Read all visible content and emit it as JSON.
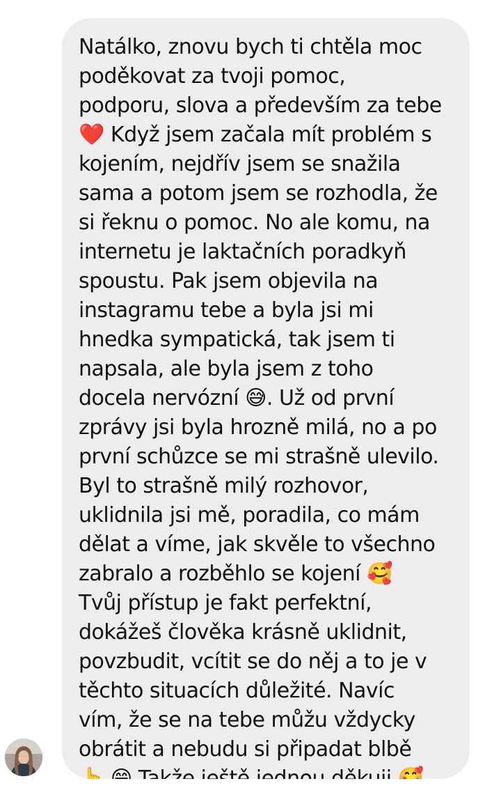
{
  "message": {
    "lines": [
      "Natálko, znovu bych ti chtěla moc",
      "poděkovat za tvoji pomoc,",
      "podporu, slova a především za tebe",
      "❤️ Když jsem začala mít problém s",
      "kojením, nejdřív jsem se snažila",
      "sama a potom jsem se rozhodla, že",
      "si řeknu o pomoc. No ale komu, na",
      "internetu je laktačních poradkyň",
      "spoustu. Pak jsem objevila na",
      "instagramu tebe a byla jsi mi",
      "hnedka sympatická, tak jsem ti",
      "napsala, ale byla jsem z toho",
      "docela nervózní 😅. Už od první",
      "zprávy jsi byla hrozně milá, no a po",
      "první schůzce se mi strašně ulevilo.",
      "Byl to strašně milý rozhovor,",
      "uklidnila jsi mě, poradila, co mám",
      "dělat a víme, jak skvěle to všechno",
      "zabralo a rozběhlo se kojení 🥰",
      "Tvůj přístup je fakt perfektní,",
      "dokážeš člověka krásně uklidnit,",
      "povzbudit, vcítit se do něj a to je v",
      "těchto situacích důležité. Navíc",
      "vím, že se na tebe můžu vždycky",
      "obrátit a nebudu si připadat blbě",
      "👆 😁 Takže ještě jednou děkuji 🥰"
    ]
  },
  "colors": {
    "bubble": "#ededf0",
    "text": "#111111",
    "background": "#ffffff"
  }
}
